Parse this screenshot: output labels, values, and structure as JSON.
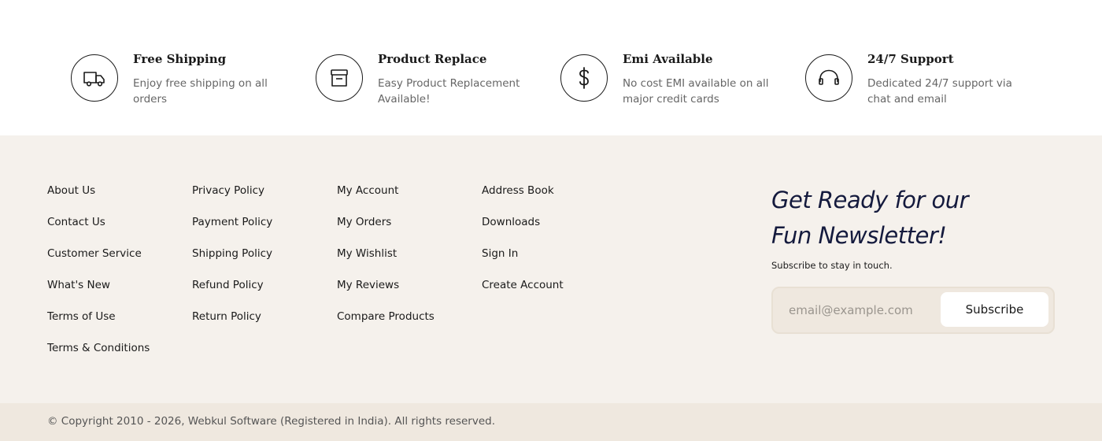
{
  "features": [
    {
      "title": "Free Shipping",
      "desc": "Enjoy free shipping on all orders",
      "icon": "truck-icon"
    },
    {
      "title": "Product Replace",
      "desc": "Easy Product Replacement Available!",
      "icon": "box-icon"
    },
    {
      "title": "Emi Available",
      "desc": "No cost EMI available on all major credit cards",
      "icon": "dollar-icon"
    },
    {
      "title": "24/7 Support",
      "desc": "Dedicated 24/7 support via chat and email",
      "icon": "headphones-icon"
    }
  ],
  "footer": {
    "columns": [
      [
        "About Us",
        "Contact Us",
        "Customer Service",
        "What's New",
        "Terms of Use",
        "Terms & Conditions"
      ],
      [
        "Privacy Policy",
        "Payment Policy",
        "Shipping Policy",
        "Refund Policy",
        "Return Policy"
      ],
      [
        "My Account",
        "My Orders",
        "My Wishlist",
        "My Reviews",
        "Compare Products"
      ],
      [
        "Address Book",
        "Downloads",
        "Sign In",
        "Create Account"
      ]
    ]
  },
  "newsletter": {
    "title_line1": "Get Ready for our",
    "title_line2": "Fun Newsletter!",
    "subtitle": "Subscribe to stay in touch.",
    "placeholder": "email@example.com",
    "button_label": "Subscribe"
  },
  "copyright": "© Copyright 2010 - 2026, Webkul Software (Registered in India). All rights reserved.",
  "colors": {
    "footer_bg": "#f5f1ec",
    "bottom_bg": "#efe8df",
    "newsletter_title": "#141a3d"
  }
}
